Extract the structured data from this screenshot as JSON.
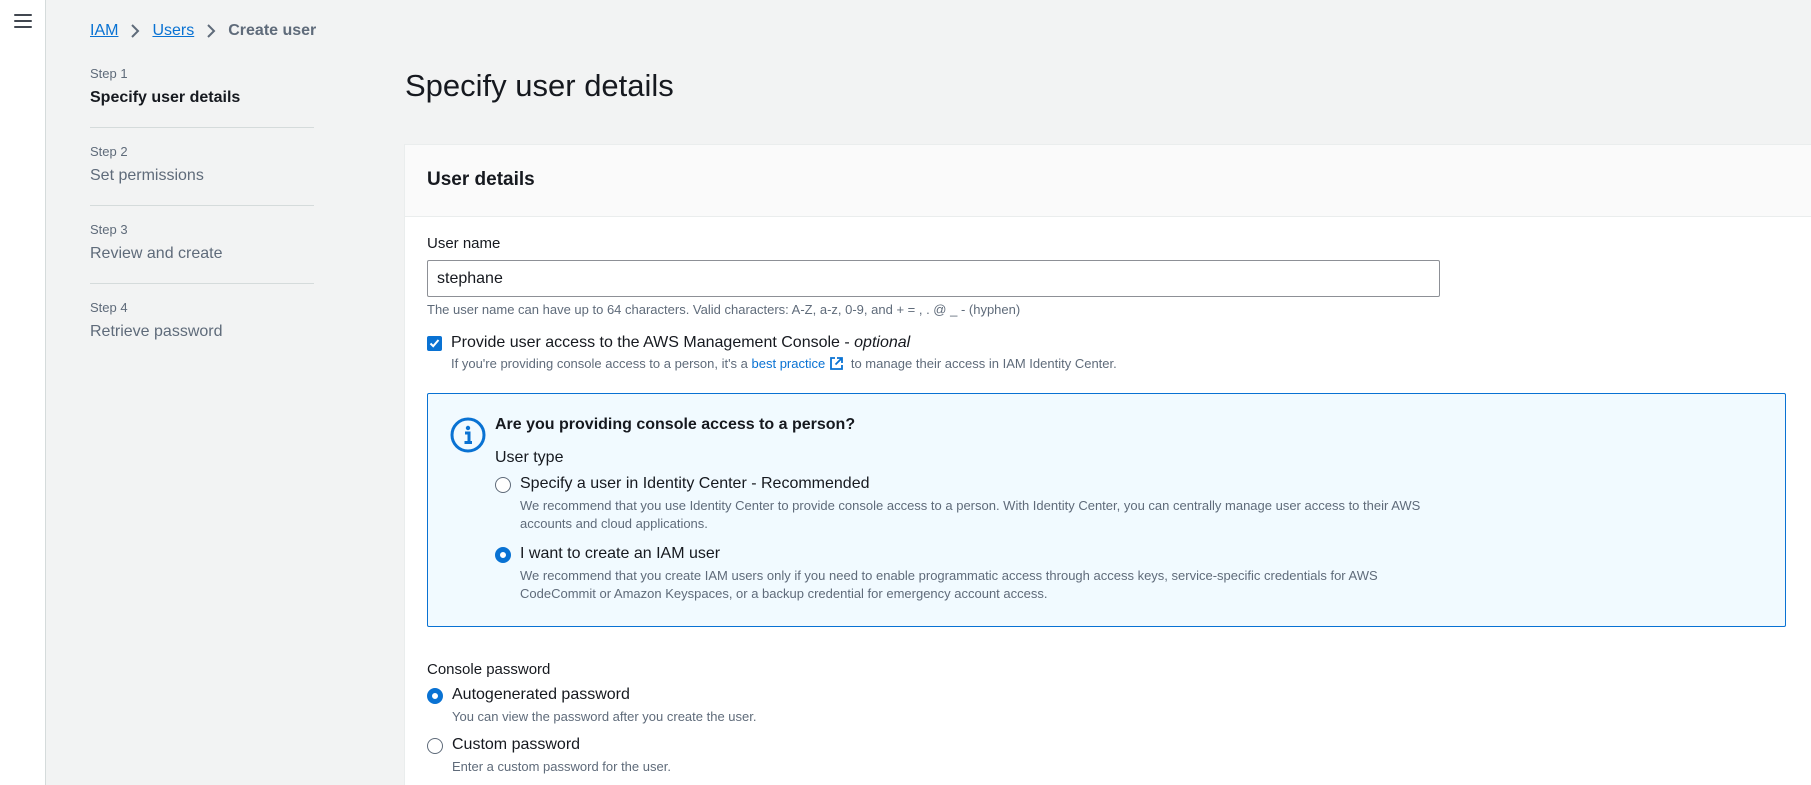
{
  "breadcrumb": {
    "iam": "IAM",
    "users": "Users",
    "current": "Create user"
  },
  "steps": [
    {
      "num": "Step 1",
      "title": "Specify user details"
    },
    {
      "num": "Step 2",
      "title": "Set permissions"
    },
    {
      "num": "Step 3",
      "title": "Review and create"
    },
    {
      "num": "Step 4",
      "title": "Retrieve password"
    }
  ],
  "page": {
    "title": "Specify user details"
  },
  "user_details": {
    "heading": "User details",
    "username_label": "User name",
    "username_value": "stephane",
    "username_hint": "The user name can have up to 64 characters. Valid characters: A-Z, a-z, 0-9, and + = , . @ _ - (hyphen)",
    "console_access_label": "Provide user access to the AWS Management Console - ",
    "console_access_optional": "optional",
    "console_access_checked": true,
    "console_desc_before": "If you're providing console access to a person, it's a ",
    "console_desc_link": "best practice",
    "console_desc_after": " to manage their access in IAM Identity Center."
  },
  "info_box": {
    "title": "Are you providing console access to a person?",
    "user_type_label": "User type",
    "options": [
      {
        "label": "Specify a user in Identity Center - Recommended",
        "desc": "We recommend that you use Identity Center to provide console access to a person. With Identity Center, you can centrally manage user access to their AWS accounts and cloud applications.",
        "checked": false
      },
      {
        "label": "I want to create an IAM user",
        "desc": "We recommend that you create IAM users only if you need to enable programmatic access through access keys, service-specific credentials for AWS CodeCommit or Amazon Keyspaces, or a backup credential for emergency account access.",
        "checked": true
      }
    ]
  },
  "console_password": {
    "label": "Console password",
    "options": [
      {
        "label": "Autogenerated password",
        "desc": "You can view the password after you create the user.",
        "checked": true
      },
      {
        "label": "Custom password",
        "desc": "Enter a custom password for the user.",
        "checked": false
      }
    ]
  },
  "colors": {
    "accent": "#0972d3",
    "info_bg": "#f1faff",
    "page_bg": "#f2f3f3"
  }
}
